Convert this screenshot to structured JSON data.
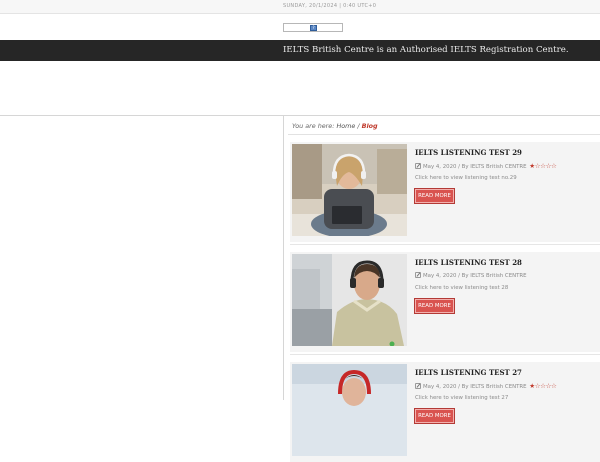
{
  "header": {
    "date": "SUNDAY, 20/1/2024 | 0:40 UTC+0",
    "banner": "IELTS British Centre is an Authorised IELTS Registration Centre."
  },
  "breadcrumb": {
    "prefix": "You are here:",
    "home": "Home",
    "separator": "/",
    "current": "Blog"
  },
  "posts": [
    {
      "title": "IELTS LISTENING TEST 29",
      "meta": "May 4, 2020 / By IELTS British CENTRE",
      "rating": "★☆☆☆☆",
      "excerpt": "Click here to view listening test no.29",
      "button": "READ MORE"
    },
    {
      "title": "IELTS LISTENING TEST 28",
      "meta": "May 4, 2020 / By IELTS British CENTRE",
      "rating": "",
      "excerpt": "Click here to view listening test 28",
      "button": "READ MORE"
    },
    {
      "title": "IELTS LISTENING TEST 27",
      "meta": "May 4, 2020 / By IELTS British CENTRE",
      "rating": "★☆☆☆☆",
      "excerpt": "Click here to view listening test 27",
      "button": "READ MORE"
    }
  ],
  "colors": {
    "accent": "#c0392b",
    "banner_bg": "#262626",
    "button": "#d9534f"
  }
}
